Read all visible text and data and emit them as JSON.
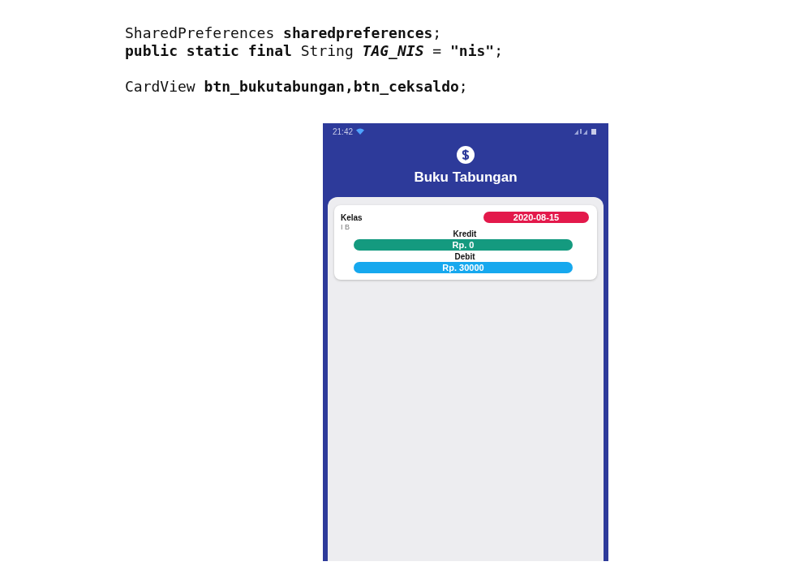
{
  "code_lines": [
    "SharedPreferences **sharedpreferences**;",
    "**public static final** String *TAG_NIS* = **\"nis\"**;",
    "CardView **btn_bukutabungan,btn_ceksaldo**;"
  ],
  "phone": {
    "status_time": "21:42",
    "title": "Buku Tabungan",
    "card": {
      "class_label": "Kelas",
      "class_value": "I B",
      "date": "2020-08-15",
      "amounts": [
        {
          "label": "Kredit",
          "value": "Rp. 0",
          "color": "#149a7f"
        },
        {
          "label": "Debit",
          "value": "Rp. 30000",
          "color": "#16a8ee"
        }
      ]
    }
  }
}
